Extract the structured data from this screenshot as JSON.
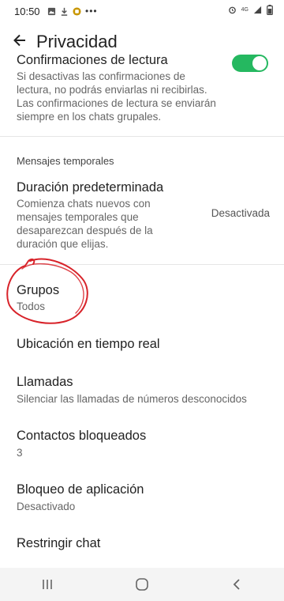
{
  "status": {
    "time": "10:50",
    "network": "4G"
  },
  "header": {
    "title": "Privacidad"
  },
  "read_receipts": {
    "title": "Confirmaciones de lectura",
    "description": [
      "Si desactivas las confirmaciones de",
      "lectura, no podrás enviarlas ni recibirlas.",
      "Las confirmaciones de lectura se enviarán",
      "siempre en los chats grupales."
    ],
    "enabled": true
  },
  "temporary": {
    "section_label": "Mensajes temporales",
    "title": "Duración predeterminada",
    "description": [
      "Comienza chats nuevos con",
      "mensajes temporales que",
      "desaparezcan después de la",
      "duración que elijas."
    ],
    "value": "Desactivada"
  },
  "groups": {
    "title": "Grupos",
    "value": "Todos"
  },
  "location": {
    "title": "Ubicación en tiempo real"
  },
  "calls": {
    "title": "Llamadas",
    "value": "Silenciar las llamadas de números desconocidos"
  },
  "blocked": {
    "title": "Contactos bloqueados",
    "value": "3"
  },
  "app_lock": {
    "title": "Bloqueo de aplicación",
    "value": "Desactivado"
  },
  "restrict": {
    "title": "Restringir chat"
  },
  "colors": {
    "accent": "#25b860",
    "annotation": "#d8232a"
  }
}
